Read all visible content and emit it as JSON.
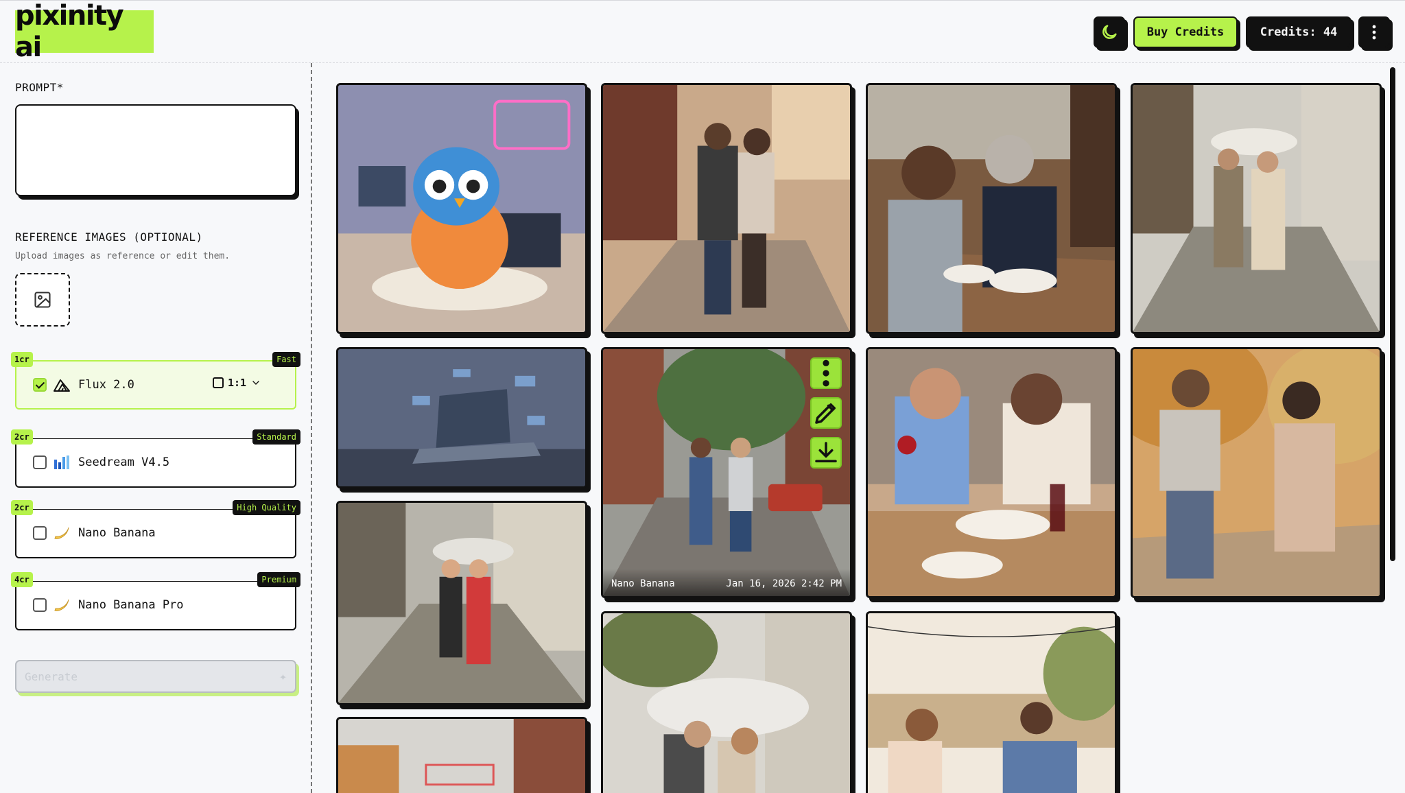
{
  "app": {
    "logo_text": "pixinity ai",
    "accent_color": "#b6f24b"
  },
  "header": {
    "theme_icon": "moon-icon",
    "buy_credits_label": "Buy Credits",
    "credits_label": "Credits: 44",
    "more_icon": "more-vertical-icon"
  },
  "sidebar": {
    "prompt_label": "PROMPT*",
    "prompt_value": "",
    "reference_title": "REFERENCE IMAGES (OPTIONAL)",
    "reference_subtitle": "Upload images as reference or edit them.",
    "upload_icon": "image-icon",
    "models": [
      {
        "credits": "1cr",
        "tag": "Fast",
        "name": "Flux 2.0",
        "checked": true,
        "icon": "flux-logo-icon",
        "ratio": "1:1"
      },
      {
        "credits": "2cr",
        "tag": "Standard",
        "name": "Seedream V4.5",
        "checked": false,
        "icon": "seedream-logo-icon"
      },
      {
        "credits": "2cr",
        "tag": "High Quality",
        "name": "Nano Banana",
        "checked": false,
        "icon": "banana-icon"
      },
      {
        "credits": "4cr",
        "tag": "Premium",
        "name": "Nano Banana Pro",
        "checked": false,
        "icon": "banana-icon"
      }
    ],
    "generate_label": "Generate"
  },
  "gallery": {
    "hover_card": {
      "model": "Nano Banana",
      "timestamp": "Jan 16, 2026 2:42 PM",
      "actions": [
        "more-vertical-icon",
        "pencil-icon",
        "download-icon"
      ]
    }
  }
}
